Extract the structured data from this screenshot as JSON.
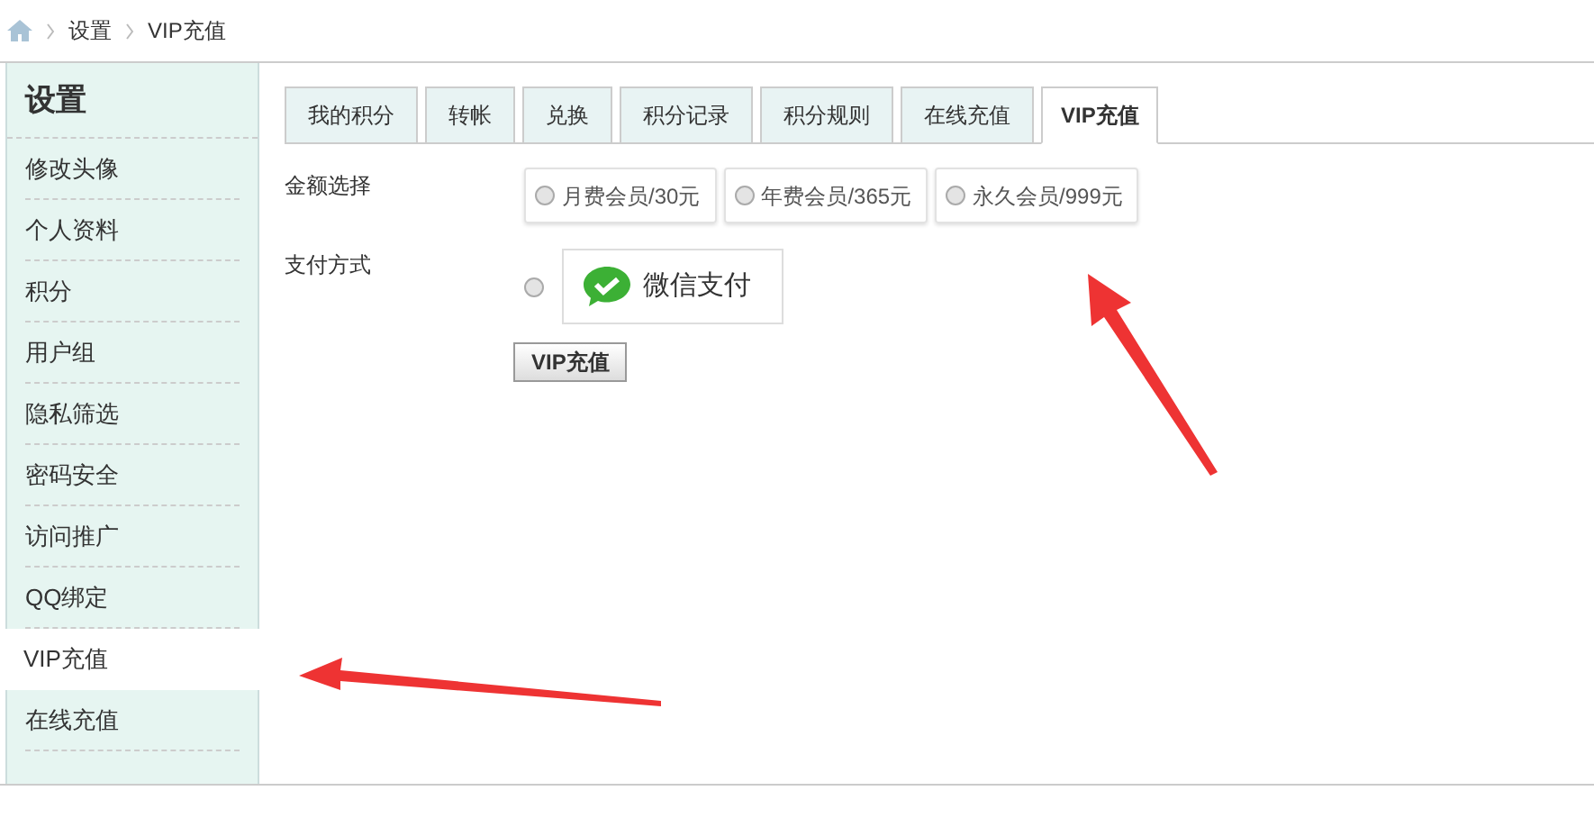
{
  "breadcrumb": [
    "设置",
    "VIP充值"
  ],
  "sidebar": {
    "title": "设置",
    "items": [
      {
        "label": "修改头像",
        "selected": false
      },
      {
        "label": "个人资料",
        "selected": false
      },
      {
        "label": "积分",
        "selected": false
      },
      {
        "label": "用户组",
        "selected": false
      },
      {
        "label": "隐私筛选",
        "selected": false
      },
      {
        "label": "密码安全",
        "selected": false
      },
      {
        "label": "访问推广",
        "selected": false
      },
      {
        "label": "QQ绑定",
        "selected": false
      },
      {
        "label": "VIP充值",
        "selected": true
      },
      {
        "label": "在线充值",
        "selected": false
      }
    ]
  },
  "tabs": [
    {
      "label": "我的积分",
      "selected": false
    },
    {
      "label": "转帐",
      "selected": false
    },
    {
      "label": "兑换",
      "selected": false
    },
    {
      "label": "积分记录",
      "selected": false
    },
    {
      "label": "积分规则",
      "selected": false
    },
    {
      "label": "在线充值",
      "selected": false
    },
    {
      "label": "VIP充值",
      "selected": true
    }
  ],
  "amount": {
    "label": "金额选择",
    "options": [
      {
        "label": "月费会员/30元",
        "selected": false
      },
      {
        "label": "年费会员/365元",
        "selected": false
      },
      {
        "label": "永久会员/999元",
        "selected": false
      }
    ]
  },
  "payment": {
    "label": "支付方式",
    "options": [
      {
        "label": "微信支付",
        "selected": false
      }
    ]
  },
  "submit_button": "VIP充值"
}
